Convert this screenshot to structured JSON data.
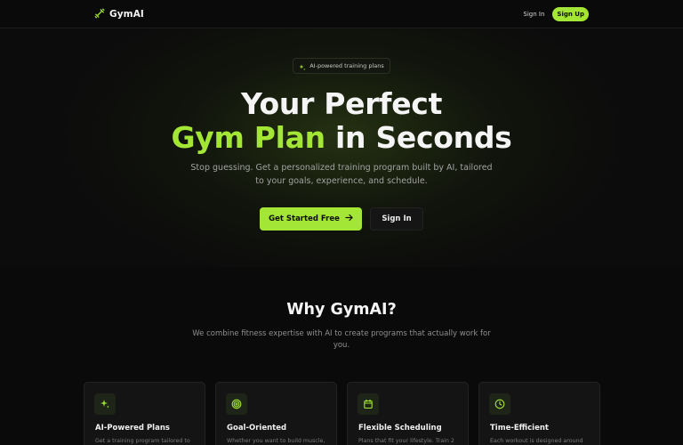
{
  "nav": {
    "brand": "GymAI",
    "sign_in": "Sign In",
    "sign_up": "Sign Up"
  },
  "hero": {
    "badge": "AI-powered training plans",
    "headline_line1": "Your Perfect",
    "headline_accent": "Gym Plan",
    "headline_rest": " in Seconds",
    "subtitle": "Stop guessing. Get a personalized training program built by AI, tailored to your goals, experience, and schedule.",
    "primary_cta": "Get Started Free",
    "secondary_cta": "Sign In"
  },
  "why": {
    "title": "Why GymAI?",
    "subtitle": "We combine fitness expertise with AI to create programs that actually work for you."
  },
  "features": [
    {
      "icon": "sparkles-icon",
      "title": "AI-Powered Plans",
      "desc": "Get a training program tailored to"
    },
    {
      "icon": "target-icon",
      "title": "Goal-Oriented",
      "desc": "Whether you want to build muscle,"
    },
    {
      "icon": "calendar-icon",
      "title": "Flexible Scheduling",
      "desc": "Plans that fit your lifestyle. Train 2"
    },
    {
      "icon": "clock-icon",
      "title": "Time-Efficient",
      "desc": "Each workout is designed around"
    }
  ],
  "colors": {
    "accent": "#a3e635",
    "background": "#0a0a0a",
    "card": "#141414",
    "muted_text": "#a3a3a3"
  }
}
